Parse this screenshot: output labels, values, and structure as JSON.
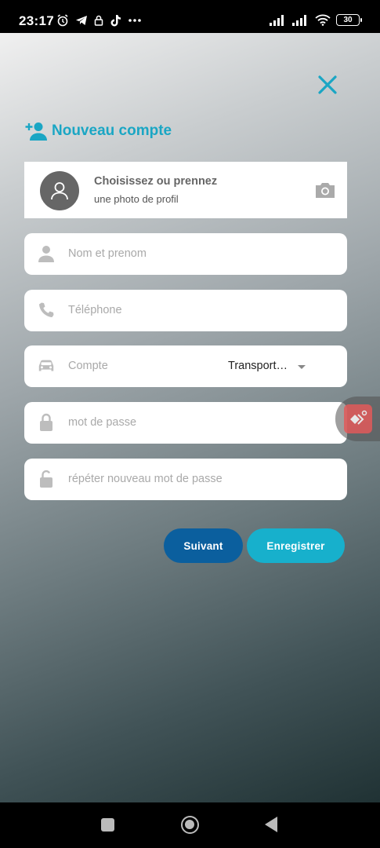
{
  "status_bar": {
    "time": "23:17",
    "battery": "30"
  },
  "header": {
    "title": "Nouveau compte"
  },
  "photo_card": {
    "title": "Choisissez ou prennez",
    "subtitle": "une photo de profil"
  },
  "form": {
    "name_placeholder": "Nom et prenom",
    "phone_placeholder": "Téléphone",
    "account_label": "Compte",
    "account_value": "Transport…",
    "password_placeholder": "mot de passe",
    "password_repeat_placeholder": "répéter nouveau mot de passe"
  },
  "buttons": {
    "next": "Suivant",
    "save": "Enregistrer"
  },
  "colors": {
    "accent": "#1aa6c4",
    "next_button": "#0b5f9e",
    "save_button": "#17b0cc"
  },
  "icons": [
    "close-icon",
    "add-person-icon",
    "avatar-icon",
    "camera-icon",
    "person-icon",
    "phone-icon",
    "car-icon",
    "lock-icon",
    "unlock-icon"
  ]
}
